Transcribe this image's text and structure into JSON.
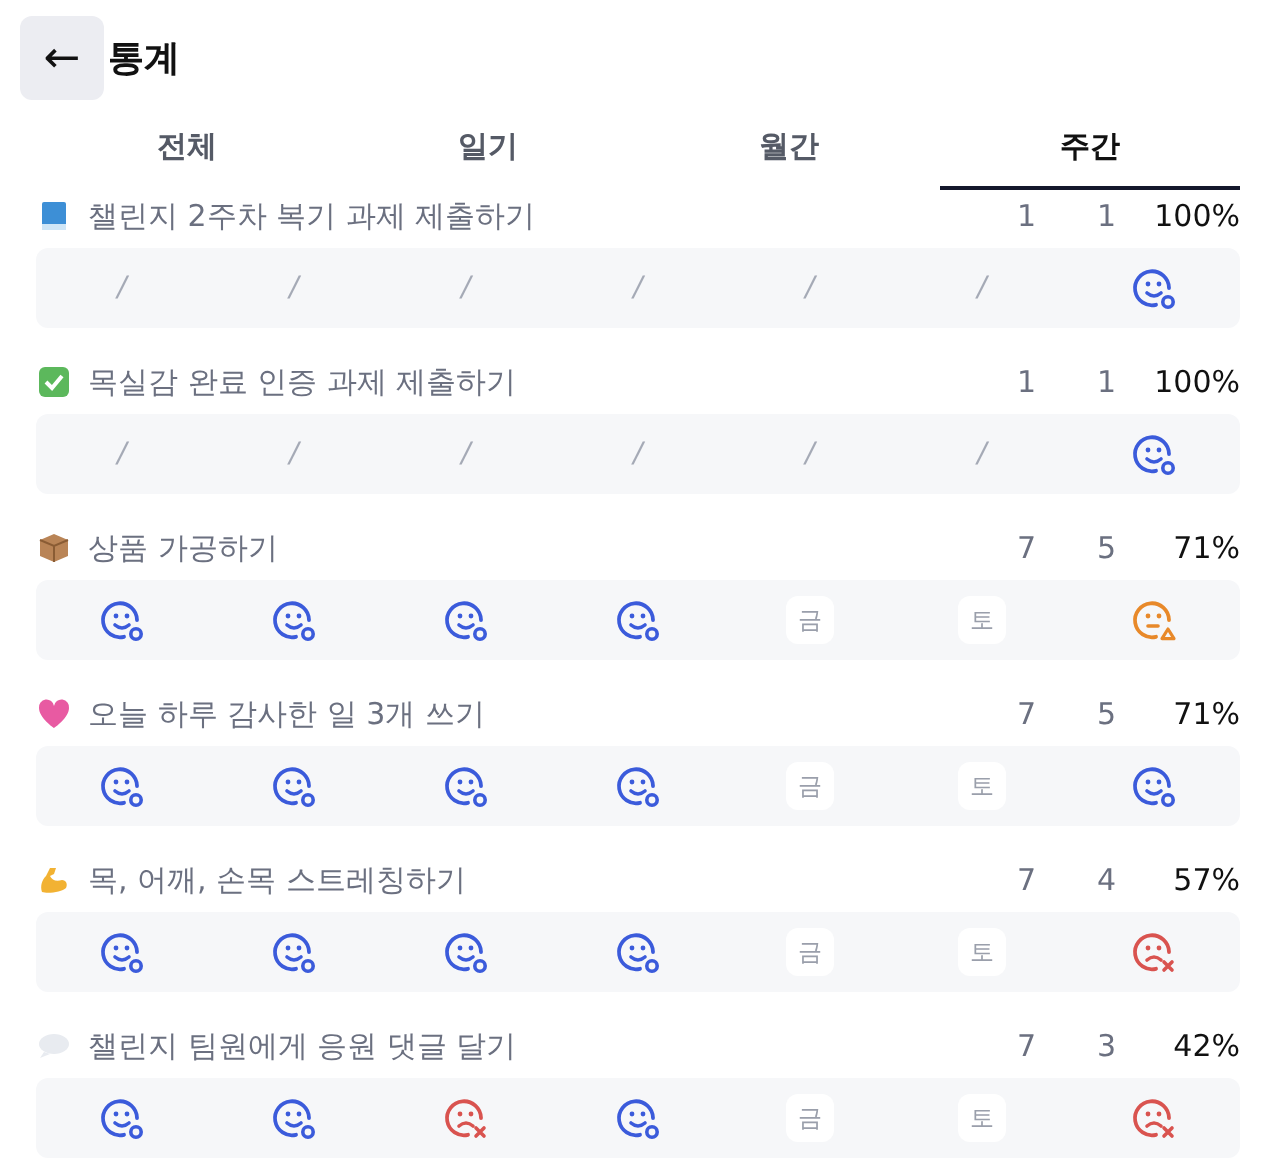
{
  "header": {
    "back": "←",
    "title": "통계"
  },
  "tabs": [
    {
      "label": "전체",
      "selected": false
    },
    {
      "label": "일기",
      "selected": false
    },
    {
      "label": "월간",
      "selected": false
    },
    {
      "label": "주간",
      "selected": true
    }
  ],
  "items": [
    {
      "kind": "book",
      "title": "챌린지 2주차 복기 과제 제출하기",
      "count_1": "1",
      "count_2": "1",
      "percent": "100%",
      "days": [
        {
          "kind": "none",
          "text": "/"
        },
        {
          "kind": "none",
          "text": "/"
        },
        {
          "kind": "none",
          "text": "/"
        },
        {
          "kind": "none",
          "text": "/"
        },
        {
          "kind": "none",
          "text": "/"
        },
        {
          "kind": "none",
          "text": "/"
        },
        {
          "kind": "done"
        }
      ]
    },
    {
      "kind": "check",
      "title": "목실감 완료 인증 과제 제출하기",
      "count_1": "1",
      "count_2": "1",
      "percent": "100%",
      "days": [
        {
          "kind": "none",
          "text": "/"
        },
        {
          "kind": "none",
          "text": "/"
        },
        {
          "kind": "none",
          "text": "/"
        },
        {
          "kind": "none",
          "text": "/"
        },
        {
          "kind": "none",
          "text": "/"
        },
        {
          "kind": "none",
          "text": "/"
        },
        {
          "kind": "done"
        }
      ]
    },
    {
      "kind": "package",
      "title": "상품 가공하기",
      "count_1": "7",
      "count_2": "5",
      "percent": "71%",
      "days": [
        {
          "kind": "done"
        },
        {
          "kind": "done"
        },
        {
          "kind": "done"
        },
        {
          "kind": "done"
        },
        {
          "kind": "off",
          "text": "금"
        },
        {
          "kind": "off",
          "text": "토"
        },
        {
          "kind": "warn"
        }
      ]
    },
    {
      "kind": "heart",
      "title": "오늘 하루 감사한 일 3개 쓰기",
      "count_1": "7",
      "count_2": "5",
      "percent": "71%",
      "days": [
        {
          "kind": "done"
        },
        {
          "kind": "done"
        },
        {
          "kind": "done"
        },
        {
          "kind": "done"
        },
        {
          "kind": "off",
          "text": "금"
        },
        {
          "kind": "off",
          "text": "토"
        },
        {
          "kind": "done"
        }
      ]
    },
    {
      "kind": "muscle",
      "title": "목, 어깨, 손목 스트레칭하기",
      "count_1": "7",
      "count_2": "4",
      "percent": "57%",
      "days": [
        {
          "kind": "done"
        },
        {
          "kind": "done"
        },
        {
          "kind": "done"
        },
        {
          "kind": "done"
        },
        {
          "kind": "off",
          "text": "금"
        },
        {
          "kind": "off",
          "text": "토"
        },
        {
          "kind": "fail"
        }
      ]
    },
    {
      "kind": "speech",
      "title": "챌린지 팀원에게 응원 댓글 달기",
      "count_1": "7",
      "count_2": "3",
      "percent": "42%",
      "days": [
        {
          "kind": "done"
        },
        {
          "kind": "done"
        },
        {
          "kind": "fail"
        },
        {
          "kind": "done"
        },
        {
          "kind": "off",
          "text": "금"
        },
        {
          "kind": "off",
          "text": "토"
        },
        {
          "kind": "fail"
        }
      ]
    }
  ]
}
